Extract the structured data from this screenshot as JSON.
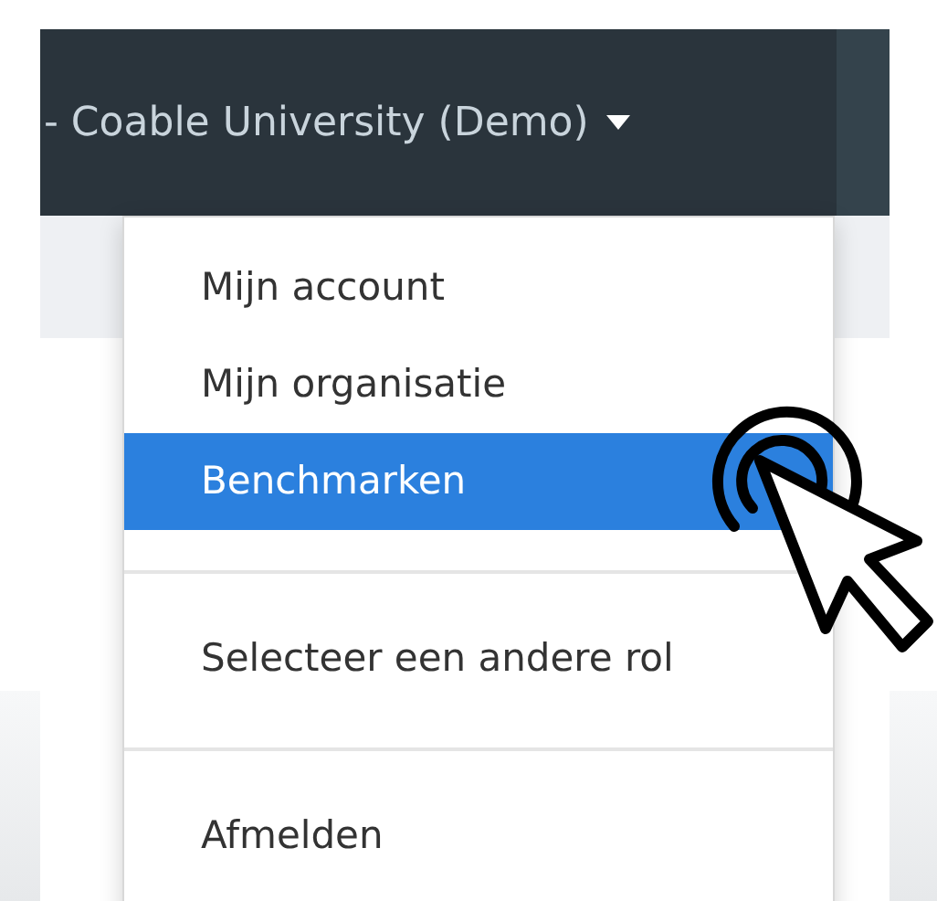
{
  "navbar": {
    "user_menu": {
      "label": "- Coable University (Demo)",
      "expanded": true
    }
  },
  "menu": {
    "groups": [
      [
        {
          "label": "Mijn account",
          "selected": false
        },
        {
          "label": "Mijn organisatie",
          "selected": false
        },
        {
          "label": "Benchmarken",
          "selected": true
        }
      ],
      [
        {
          "label": "Selecteer een andere rol",
          "selected": false
        }
      ],
      [
        {
          "label": "Afmelden",
          "selected": false
        }
      ]
    ]
  }
}
